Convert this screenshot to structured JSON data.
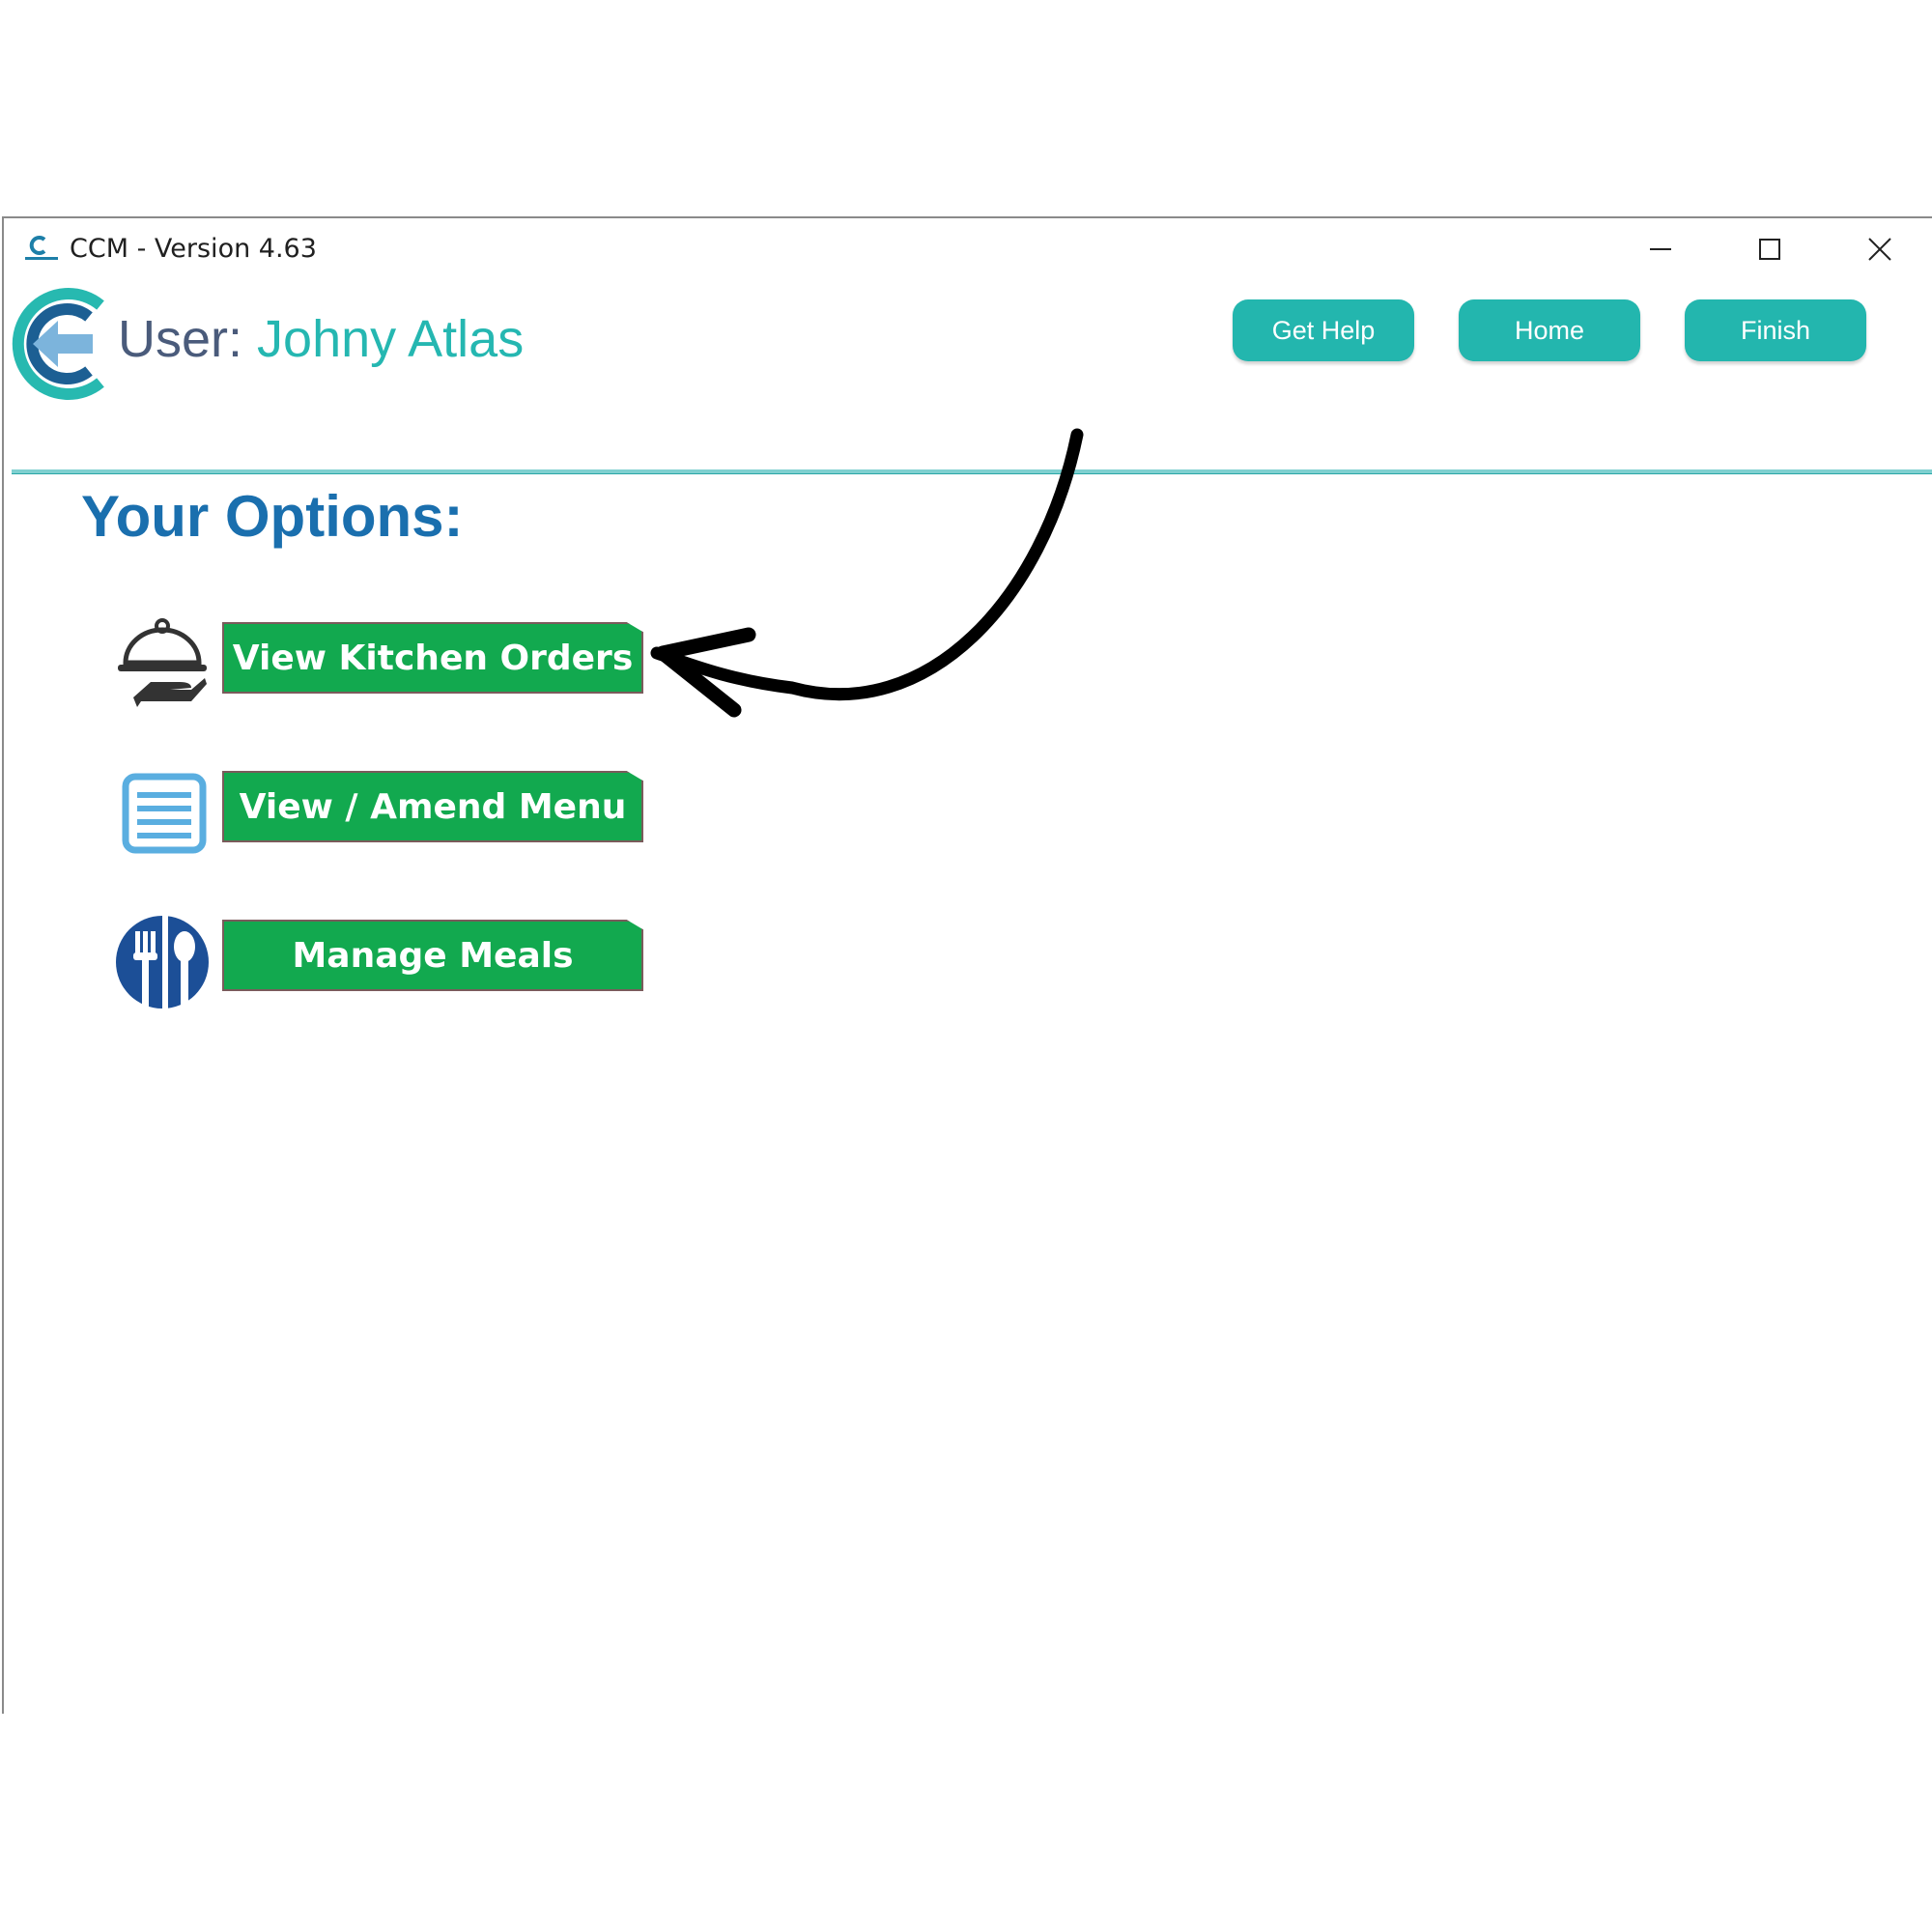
{
  "window": {
    "title": "CCM - Version 4.63",
    "controls": [
      "minimize-icon",
      "maximize-icon",
      "close-icon"
    ]
  },
  "header": {
    "user_label": "User:",
    "user_name": "Johny Atlas",
    "buttons": {
      "get_help": "Get Help",
      "home": "Home",
      "finish": "Finish"
    }
  },
  "main": {
    "title": "Your Options:",
    "options": [
      {
        "label": "View Kitchen Orders",
        "icon": "serving-cloche-icon"
      },
      {
        "label": "View / Amend Menu",
        "icon": "menu-list-icon"
      },
      {
        "label": "Manage Meals",
        "icon": "cutlery-icon"
      }
    ]
  },
  "colors": {
    "accent_teal": "#23b6ae",
    "title_blue": "#1a6fae",
    "user_label": "#4a5b7b",
    "option_green": "#12a94f",
    "annotation_arrow": "#000000"
  }
}
